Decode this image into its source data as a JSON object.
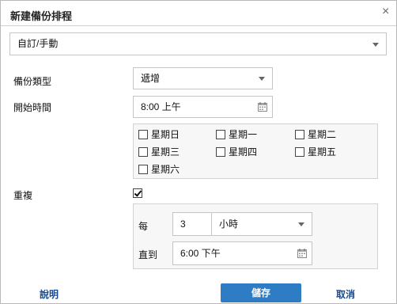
{
  "dialog": {
    "title": "新建備份排程",
    "close_glyph": "×"
  },
  "schedule_type": {
    "value": "自訂/手動"
  },
  "backup_type": {
    "label": "備份類型",
    "value": "遞增"
  },
  "start_time": {
    "label": "開始時間",
    "value": "8:00 上午"
  },
  "days": [
    {
      "label": "星期日",
      "checked": false
    },
    {
      "label": "星期一",
      "checked": false
    },
    {
      "label": "星期二",
      "checked": false
    },
    {
      "label": "星期三",
      "checked": false
    },
    {
      "label": "星期四",
      "checked": false
    },
    {
      "label": "星期五",
      "checked": false
    },
    {
      "label": "星期六",
      "checked": false
    }
  ],
  "repeat": {
    "label": "重複",
    "checked": true,
    "every_label": "每",
    "every_value": "3",
    "unit": "小時",
    "until_label": "直到",
    "until_value": "6:00 下午"
  },
  "footer": {
    "help": "說明",
    "save": "儲存",
    "cancel": "取消"
  },
  "colors": {
    "primary": "#2d7cc4",
    "link": "#1a4a8a"
  },
  "icons": {
    "calendar": "calendar-icon",
    "dropdown": "chevron-down-icon",
    "close": "close-icon"
  }
}
